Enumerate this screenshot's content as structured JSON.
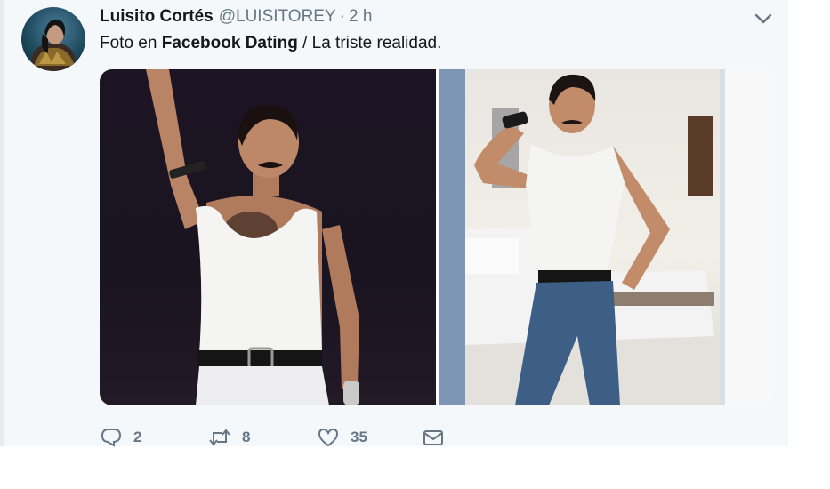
{
  "tweet": {
    "author_name": "Luisito Cortés",
    "handle": "@LUISITOREY",
    "separator": "·",
    "time": "2 h",
    "text_prefix": "Foto en ",
    "text_bold": "Facebook Dating",
    "text_suffix": " / La triste realidad.",
    "media_count": 2
  },
  "actions": {
    "reply_count": "2",
    "retweet_count": "8",
    "like_count": "35"
  },
  "icons": {
    "reply": "reply-icon",
    "retweet": "retweet-icon",
    "like": "heart-icon",
    "dm": "envelope-icon",
    "more": "chevron-down-icon"
  },
  "colors": {
    "card_bg": "#f5f8fa",
    "text": "#14171a",
    "secondary": "#657786"
  }
}
